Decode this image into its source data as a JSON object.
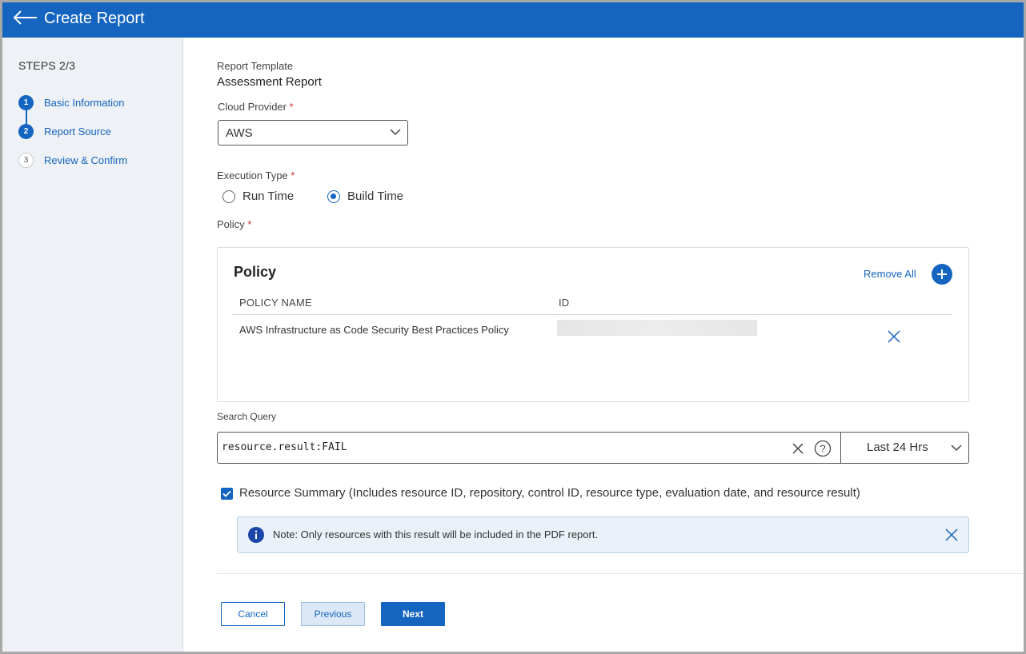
{
  "header": {
    "title": "Create Report"
  },
  "sidebar": {
    "steps_label": "STEPS 2/3",
    "steps": [
      {
        "number": "1",
        "label": "Basic Information",
        "state": "done"
      },
      {
        "number": "2",
        "label": "Report Source",
        "state": "current"
      },
      {
        "number": "3",
        "label": "Review & Confirm",
        "state": "todo"
      }
    ]
  },
  "form": {
    "template_label": "Report Template",
    "template_value": "Assessment Report",
    "cloud_provider_label": "Cloud Provider",
    "cloud_provider_value": "AWS",
    "execution_type_label": "Execution Type",
    "execution_options": [
      {
        "label": "Run Time",
        "selected": false
      },
      {
        "label": "Build Time",
        "selected": true
      }
    ],
    "policy_label": "Policy",
    "required_mark": "*"
  },
  "policy_card": {
    "title": "Policy",
    "remove_all": "Remove All",
    "columns": [
      "POLICY NAME",
      "ID"
    ],
    "rows": [
      {
        "name": "AWS Infrastructure as Code Security Best Practices Policy"
      }
    ]
  },
  "search": {
    "label": "Search Query",
    "value": "resource.result:FAIL",
    "time_range": "Last 24 Hrs"
  },
  "resource_summary": {
    "checked": true,
    "label": "Resource Summary (Includes resource ID, repository, control ID, resource type, evaluation date, and resource result)"
  },
  "note": {
    "text": "Note: Only resources with this result will be included in the PDF report."
  },
  "buttons": {
    "cancel": "Cancel",
    "previous": "Previous",
    "next": "Next"
  },
  "colors": {
    "primary": "#1565c0",
    "required": "#d32f2f",
    "sidebar_bg": "#eef1f5",
    "note_bg": "#eaf1f8"
  }
}
